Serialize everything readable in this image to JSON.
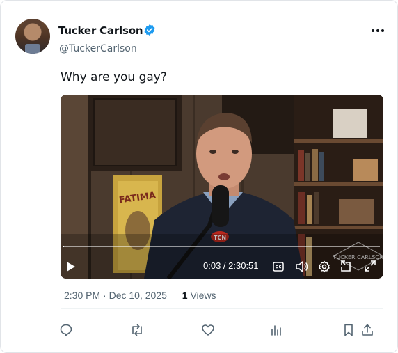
{
  "author": {
    "name": "Tucker Carlson",
    "handle": "@TuckerCarlson",
    "verified": true,
    "avatar_icon": "profile-photo"
  },
  "tweet": {
    "text": "Why are you gay?"
  },
  "video": {
    "current_time": "0:03",
    "duration": "2:30:51",
    "time_display": "0:03 / 2:30:51",
    "progress_fraction": 0.005,
    "watermark": "TUCKER CARLSON",
    "poster_text": "FATIMA",
    "mic_badge": "TCN",
    "controls": [
      "play-icon",
      "captions-icon",
      "volume-icon",
      "settings-icon",
      "pip-icon",
      "fullscreen-icon"
    ]
  },
  "meta": {
    "time": "2:30 PM",
    "separator": "·",
    "date": "Dec 10, 2025",
    "views_count": "1",
    "views_label": "Views"
  },
  "actions": [
    "reply-icon",
    "retweet-icon",
    "like-icon",
    "analytics-icon",
    "bookmark-icon",
    "share-icon"
  ],
  "colors": {
    "verified": "#1d9bf0",
    "secondary_text": "#536471",
    "text": "#0f1419"
  }
}
